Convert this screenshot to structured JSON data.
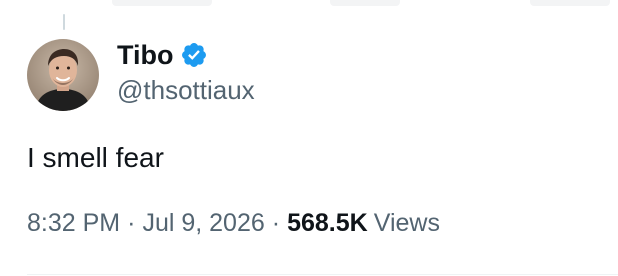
{
  "author": {
    "display_name": "Tibo",
    "handle": "@thsottiaux",
    "verified": true,
    "verified_color": "#1d9bf0"
  },
  "tweet": {
    "text": "I smell fear",
    "time": "8:32 PM",
    "separator": "·",
    "date": "Jul 9, 2026",
    "views_count": "568.5K",
    "views_label": "Views"
  },
  "icons": {
    "avatar": "user-photo-avatar",
    "verified": "verified-badge-icon"
  },
  "colors": {
    "text_primary": "#0f1419",
    "text_secondary": "#536471",
    "divider": "#eff3f4"
  }
}
